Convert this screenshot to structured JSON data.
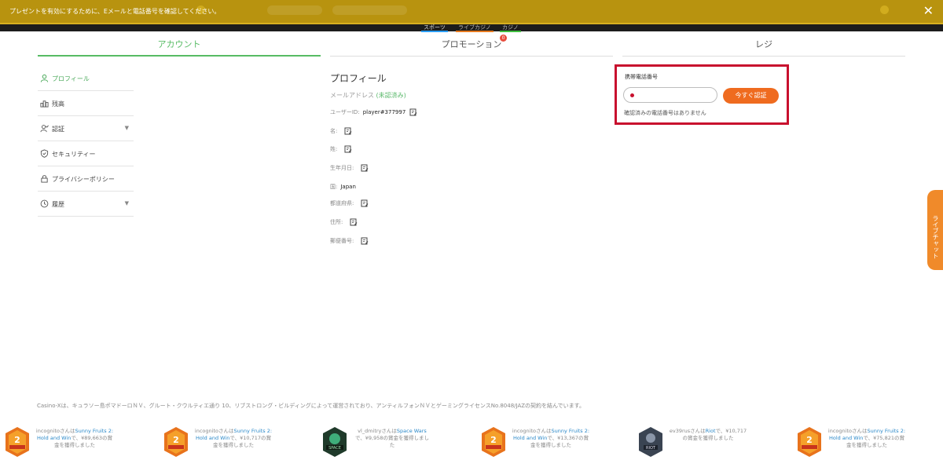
{
  "notice": {
    "text": "プレゼントを有効にするために、Eメールと電話番号を確認してください。",
    "close": "✕"
  },
  "top_nav": [
    "スポーツ",
    "ライブカジノ",
    "カジノ"
  ],
  "tabs": {
    "account": "アカウント",
    "promotion": "プロモーション",
    "promotion_badge": "0",
    "cashier": "レジ"
  },
  "sidebar": [
    {
      "label": "プロフィール",
      "icon": "user-icon",
      "active": true
    },
    {
      "label": "残高",
      "icon": "balance-icon"
    },
    {
      "label": "認証",
      "icon": "verification-icon",
      "expandable": true
    },
    {
      "label": "セキュリティー",
      "icon": "shield-icon"
    },
    {
      "label": "プライバシーポリシー",
      "icon": "lock-icon"
    },
    {
      "label": "履歴",
      "icon": "clock-icon",
      "expandable": true
    }
  ],
  "profile": {
    "title": "プロフィール",
    "email_label": "メールアドレス",
    "email_status": "(未認済み)",
    "fields": [
      {
        "label": "ユーザーID:",
        "value": "player#377997"
      },
      {
        "label": "名:",
        "value": ""
      },
      {
        "label": "姓:",
        "value": ""
      },
      {
        "label": "生年月日:",
        "value": ""
      },
      {
        "label": "国:",
        "value": "Japan"
      },
      {
        "label": "都道府県:",
        "value": ""
      },
      {
        "label": "住所:",
        "value": ""
      },
      {
        "label": "郵便番号:",
        "value": ""
      }
    ]
  },
  "phone": {
    "label": "携帯電話番号",
    "input_value": "",
    "verify_button": "今すぐ認証",
    "status": "確認済みの電話番号はありません"
  },
  "live_chat": "ライブチャット",
  "footer": {
    "license": "Casino-Xは、キュラソー島ポマドーロＮＶ、グルート・クウルティエ通り 10、リブストロング・ビルディングによって運営されており、アンティルフォンＮＶとゲーミングライセンスNo.8048/JAZの契約を結んでいます。",
    "wins": [
      {
        "user": "incognito",
        "connector": "さんは",
        "game": "Sunny Fruits 2: Hold and Win",
        "suffix": "で、",
        "amount": "¥89,663",
        "tail": "の賞金を獲得しました",
        "thumb": "sunny-fruits-icon"
      },
      {
        "user": "incognito",
        "connector": "さんは",
        "game": "Sunny Fruits 2: Hold and Win",
        "suffix": "で、",
        "amount": "¥10,717",
        "tail": "の賞金を獲得しました",
        "thumb": "sunny-fruits-icon"
      },
      {
        "user": "vl_dmitry",
        "connector": "さんは",
        "game": "Space Wars",
        "suffix": "で、",
        "amount": "¥9,958",
        "tail": "の賞金を獲得しました",
        "thumb": "space-wars-icon"
      },
      {
        "user": "incognito",
        "connector": "さんは",
        "game": "Sunny Fruits 2: Hold and Win",
        "suffix": "で、",
        "amount": "¥13,367",
        "tail": "の賞金を獲得しました",
        "thumb": "sunny-fruits-icon"
      },
      {
        "user": "ev39rus",
        "connector": "さんは",
        "game": "Riot",
        "suffix": "で、",
        "amount": "¥10,717",
        "tail": "の賞金を獲得しました",
        "thumb": "riot-icon"
      },
      {
        "user": "incognito",
        "connector": "さんは",
        "game": "Sunny Fruits 2: Hold and Win",
        "suffix": "で、",
        "amount": "¥75,821",
        "tail": "の賞金を獲得しました",
        "thumb": "sunny-fruits-icon"
      }
    ]
  },
  "colors": {
    "notice_bg": "#b8930f",
    "accent_green": "#57bb64",
    "verify_orange": "#ef6b1f",
    "highlight_red": "#c8102e",
    "live_chat_orange": "#f08a2a"
  }
}
